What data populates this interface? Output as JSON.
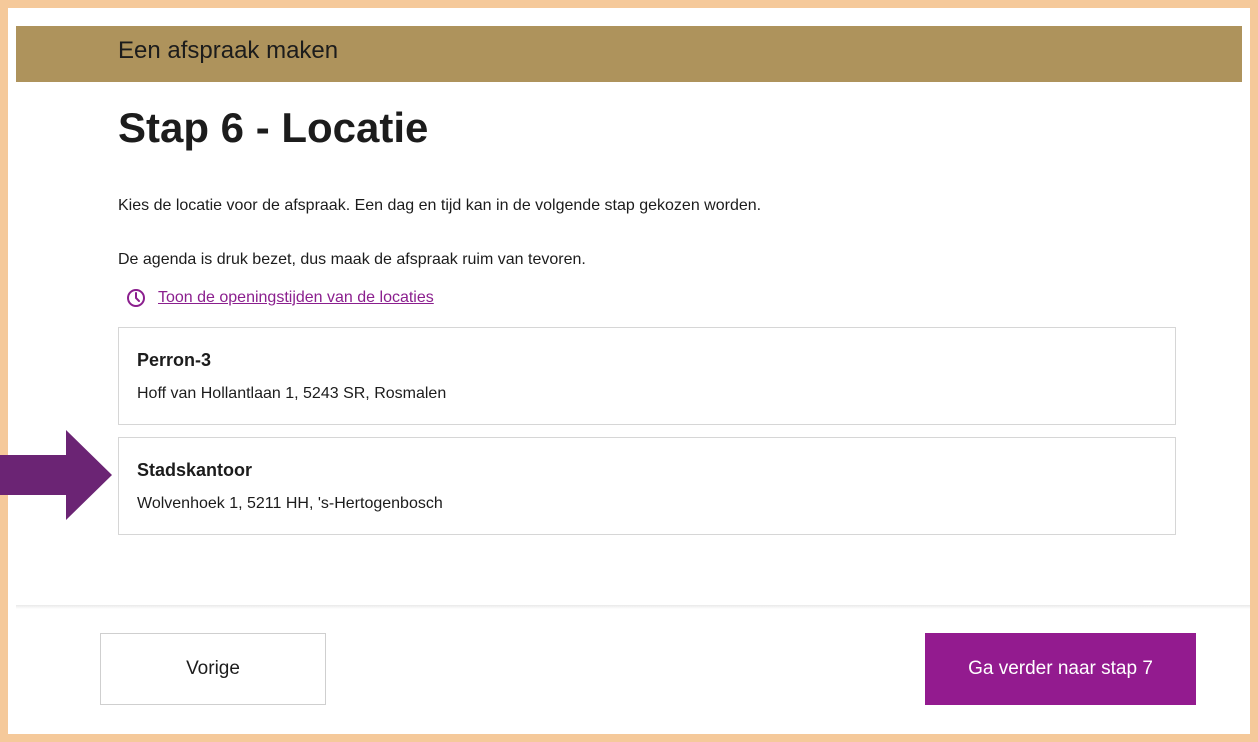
{
  "header": {
    "title": "Een afspraak maken"
  },
  "page": {
    "title": "Stap 6 - Locatie",
    "intro": "Kies de locatie voor de afspraak. Een dag en tijd kan in de volgende stap gekozen worden.",
    "notice": "De agenda is druk bezet, dus maak de afspraak ruim van tevoren.",
    "hours_link": {
      "label": "Toon de openingstijden van de locaties",
      "icon": "clock-icon"
    }
  },
  "locations": [
    {
      "name": "Perron-3",
      "address": "Hoff van Hollantlaan 1, 5243 SR, Rosmalen"
    },
    {
      "name": "Stadskantoor",
      "address": "Wolvenhoek 1, 5211 HH, 's-Hertogenbosch"
    }
  ],
  "footer": {
    "prev_label": "Vorige",
    "next_label": "Ga verder naar stap 7"
  },
  "colors": {
    "frame": "#f5c99a",
    "header_bar": "#ae935c",
    "accent_purple": "#931b8f",
    "link_purple": "#8b1f8e",
    "arrow_purple": "#6b2474"
  }
}
